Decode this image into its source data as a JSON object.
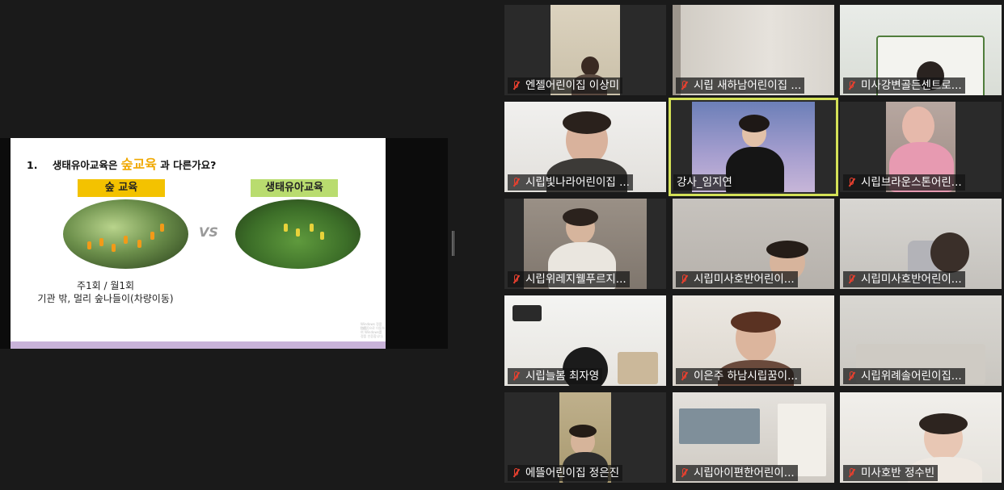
{
  "slide": {
    "title_number": "1.",
    "title_prefix": "생태유아교육은",
    "title_highlight": "숲교육",
    "title_suffix": "과 다른가요?",
    "left_tag": "숲 교육",
    "right_tag": "생태유아교육",
    "vs_text": "VS",
    "freq_line": "주1회 / 월1회",
    "place_line": "기관 밖, 멀리 숲나들이(차량이동)",
    "watermark_line1": "Windows 정품 인증",
    "watermark_line2": "[설정]으로 이동하여 Windows를 정품 인증합니다."
  },
  "participants": [
    {
      "name": "엔젤어린이집 이상미",
      "muted": true,
      "active": false
    },
    {
      "name": "시립 새하남어린이집 ...",
      "muted": true,
      "active": false
    },
    {
      "name": "미사강변골든센트로...",
      "muted": true,
      "active": false
    },
    {
      "name": "시립빛나라어린이집 ...",
      "muted": true,
      "active": false
    },
    {
      "name": "강사_임지연",
      "muted": false,
      "active": true
    },
    {
      "name": "시립브라운스톤어린...",
      "muted": true,
      "active": false
    },
    {
      "name": "시립위레지웰푸르지...",
      "muted": true,
      "active": false
    },
    {
      "name": "시립미사호반어린이...",
      "muted": true,
      "active": false
    },
    {
      "name": "시립미사호반어린이...",
      "muted": true,
      "active": false
    },
    {
      "name": "시립늘봄 최자영",
      "muted": true,
      "active": false
    },
    {
      "name": "이은주 하남시립꿈이...",
      "muted": true,
      "active": false
    },
    {
      "name": "시립위례솔어린이집...",
      "muted": true,
      "active": false
    },
    {
      "name": "에뜰어린이집 정은진",
      "muted": true,
      "active": false
    },
    {
      "name": "시립아이편한어린이...",
      "muted": true,
      "active": false
    },
    {
      "name": "미사호반 정수빈",
      "muted": true,
      "active": false
    }
  ],
  "colors": {
    "active_border": "#d4e157",
    "muted_icon": "#e8402f",
    "highlight": "#f0a800"
  }
}
